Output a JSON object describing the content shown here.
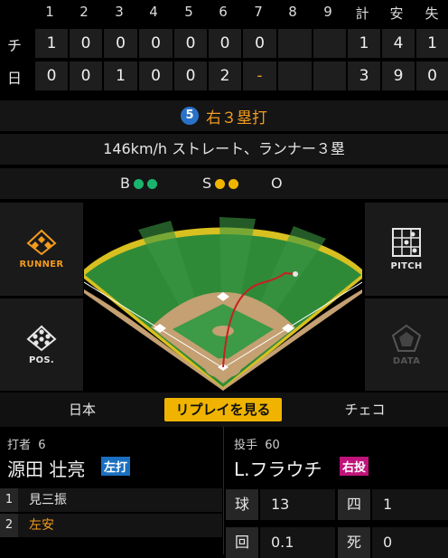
{
  "scoreboard": {
    "headers": [
      "1",
      "2",
      "3",
      "4",
      "5",
      "6",
      "7",
      "8",
      "9",
      "計",
      "安",
      "失"
    ],
    "rows": [
      {
        "team": "チ",
        "innings": [
          "1",
          "0",
          "0",
          "0",
          "0",
          "0",
          "0",
          "",
          ""
        ],
        "totals": [
          "1",
          "4",
          "1"
        ]
      },
      {
        "team": "日",
        "innings": [
          "0",
          "0",
          "1",
          "0",
          "0",
          "2",
          "-",
          "",
          ""
        ],
        "totals": [
          "3",
          "9",
          "0"
        ]
      }
    ]
  },
  "play": {
    "batter_order": "5",
    "result": "右３塁打",
    "description": "146km/h ストレート、ランナー３塁",
    "count": {
      "ball_label": "B",
      "balls": 2,
      "strike_label": "S",
      "strikes": 2,
      "out_label": "O",
      "outs": 0
    }
  },
  "field_buttons": {
    "runner": "RUNNER",
    "pos": "POS.",
    "pitch": "PITCH",
    "data": "DATA"
  },
  "tabs": [
    "日本",
    "リプレイを見る",
    "チェコ"
  ],
  "batter": {
    "role": "打者",
    "number": "6",
    "name": "源田 壮亮",
    "hand": "左打",
    "at_bats": [
      {
        "num": "1",
        "result": "見三振"
      },
      {
        "num": "2",
        "result": "左安"
      }
    ]
  },
  "pitcher": {
    "role": "投手",
    "number": "60",
    "name": "L.フラウチ",
    "hand": "右投",
    "stats": [
      {
        "label": "球",
        "value": "13"
      },
      {
        "label": "四",
        "value": "1"
      },
      {
        "label": "回",
        "value": "0.1"
      },
      {
        "label": "死",
        "value": "0"
      }
    ]
  },
  "colors": {
    "accent_orange": "#f29b1e",
    "ball_green": "#19b46e",
    "strike_yellow": "#f0b400",
    "batter_order_blue": "#2a72c9",
    "left_bat_blue": "#1a6fc0",
    "right_throw_magenta": "#c0137a",
    "tab_active": "#f0b400"
  }
}
